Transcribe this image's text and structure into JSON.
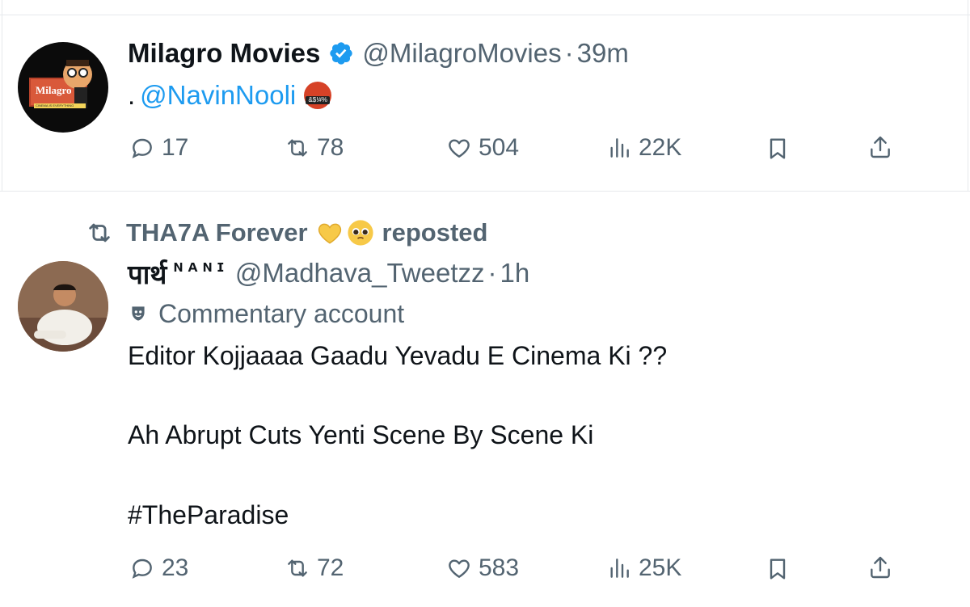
{
  "tweet1": {
    "display_name": "Milagro Movies",
    "handle": "@MilagroMovies",
    "dot": "·",
    "time": "39m",
    "text_prefix": ".",
    "mention": "@NavinNooli",
    "avatar_logo_text": "Milagro",
    "avatar_tagline": "CINEMA IS EVERYTHING",
    "emoji_text": "&$!#%",
    "actions": {
      "replies": "17",
      "reposts": "78",
      "likes": "504",
      "views": "22K"
    }
  },
  "tweet2": {
    "repost_by": "THA7A Forever",
    "repost_label": "reposted",
    "display_name": "पार्थ",
    "display_name_suffix": "ɴᴀɴɪ",
    "handle": "@Madhava_Tweetzz",
    "dot": "·",
    "time": "1h",
    "account_label": "Commentary account",
    "text_line1": "Editor Kojjaaaa Gaadu Yevadu E Cinema Ki ??",
    "text_line2": "Ah Abrupt Cuts Yenti Scene By Scene Ki",
    "hashtag": "#TheParadise",
    "actions": {
      "replies": "23",
      "reposts": "72",
      "likes": "583",
      "views": "25K"
    }
  },
  "colors": {
    "accent": "#1d9bf0",
    "muted": "#536471",
    "text": "#0f1419",
    "verified": "#1d9bf0",
    "heart_emoji": "#f7c948"
  }
}
